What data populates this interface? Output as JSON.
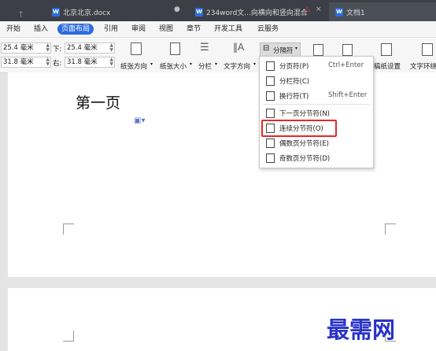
{
  "tabs": [
    {
      "label": "北京北京.docx"
    },
    {
      "label": "234word文...向横向和竖向混合"
    },
    {
      "label": "文档1"
    }
  ],
  "menu": [
    "开始",
    "插入",
    "页面布局",
    "引用",
    "审阅",
    "视图",
    "章节",
    "开发工具",
    "云服务"
  ],
  "margins": {
    "top_value": "25.4 毫米",
    "bottom_label": "下:",
    "bottom_value": "25.4 毫米",
    "left_value": "31.8 毫米",
    "right_label": "右:",
    "right_value": "31.8 毫米"
  },
  "ribbon": {
    "orientation": "纸张方向",
    "size": "纸张大小",
    "columns": "分栏",
    "text_direction": "文字方向",
    "breaks": "分隔符",
    "grid_paper": "稿纸设置",
    "text_wrap": "文字环绕"
  },
  "dropdown": [
    {
      "label": "分页符(P)",
      "shortcut": "Ctrl+Enter"
    },
    {
      "label": "分栏符(C)",
      "shortcut": ""
    },
    {
      "label": "换行符(T)",
      "shortcut": "Shift+Enter"
    },
    {
      "label": "下一页分节符(N)",
      "shortcut": ""
    },
    {
      "label": "连续分节符(O)",
      "shortcut": ""
    },
    {
      "label": "偶数页分节符(E)",
      "shortcut": ""
    },
    {
      "label": "奇数页分节符(D)",
      "shortcut": ""
    }
  ],
  "document": {
    "heading": "第一页"
  },
  "watermark": "最需网",
  "colors": {
    "accent": "#2d6be0",
    "highlight": "#e02a2a",
    "watermark": "#2a33c8"
  }
}
